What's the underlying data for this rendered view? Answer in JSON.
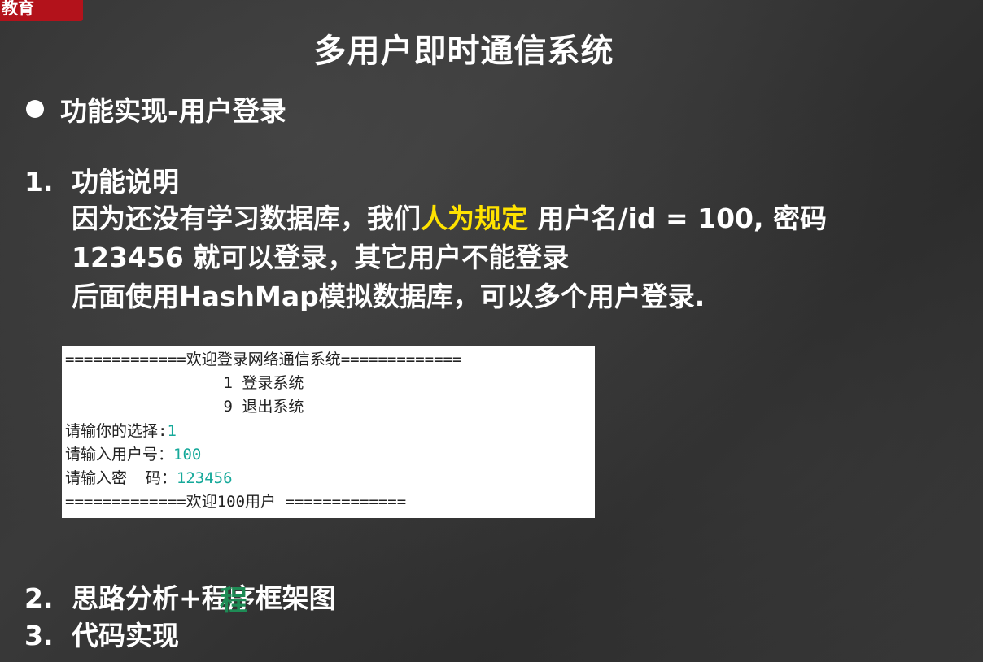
{
  "badge": "教育",
  "title": "多用户即时通信系统",
  "bullet": "功能实现-用户登录",
  "section1": {
    "num": "1.",
    "heading": "功能说明",
    "line1_a": "因为还没有学习数据库，我们",
    "line1_hl": "人为规定",
    "line1_b": " 用户名/id = 100, 密码",
    "line2": "123456 就可以登录，其它用户不能登录",
    "line3": "后面使用HashMap模拟数据库，可以多个用户登录."
  },
  "console": {
    "header": "=============欢迎登录网络通信系统=============",
    "menu1": "                 1 登录系统",
    "menu9": "                 9 退出系统",
    "choice_label": "请输你的选择:",
    "choice_value": "1",
    "user_label": "请输入用户号：",
    "user_value": "100",
    "pwd_label": "请输入密  码：",
    "pwd_value": "123456",
    "footer": "=============欢迎100用户 ============="
  },
  "section2": {
    "num": "2.",
    "text": "思路分析+程序框架图"
  },
  "section3": {
    "num": "3.",
    "text": "代码实现"
  },
  "annotation_mark": "程",
  "colors": {
    "highlight": "#ffe300",
    "input": "#16a99a",
    "badge": "#b3121b"
  }
}
